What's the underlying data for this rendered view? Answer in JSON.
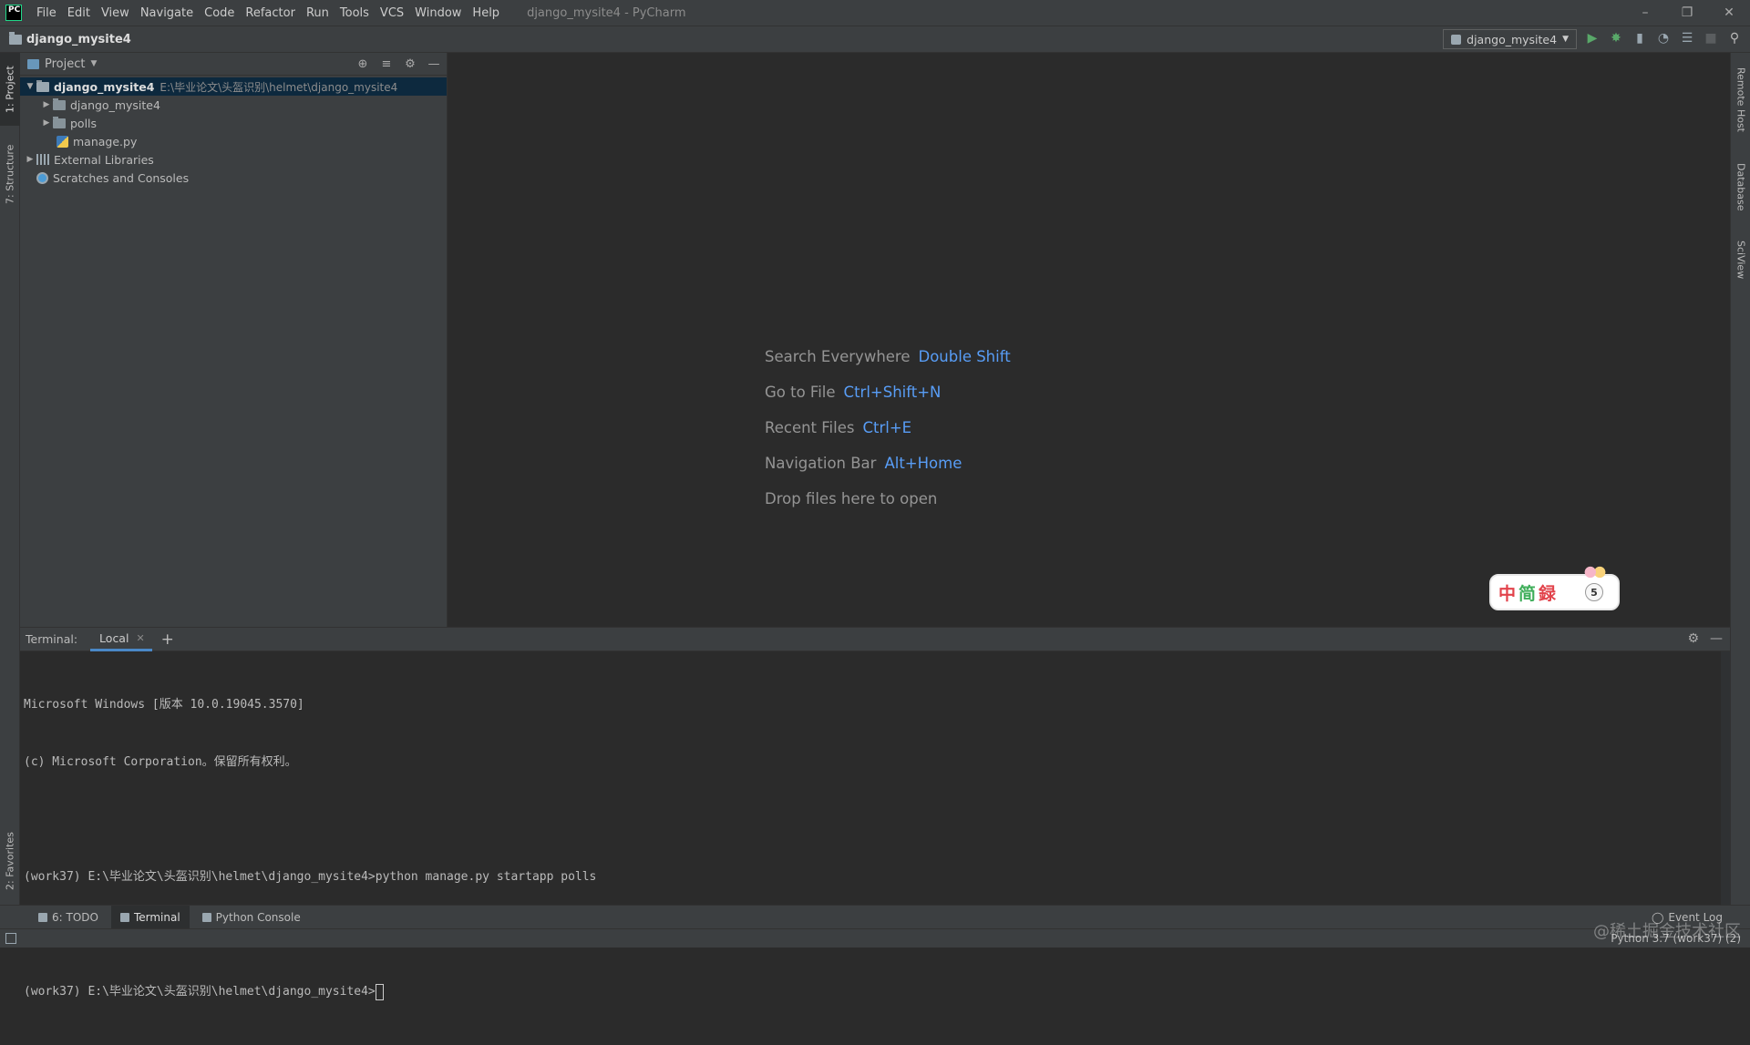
{
  "titlebar": {
    "menu": [
      "File",
      "Edit",
      "View",
      "Navigate",
      "Code",
      "Refactor",
      "Run",
      "Tools",
      "VCS",
      "Window",
      "Help"
    ],
    "window_title": "django_mysite4 - PyCharm"
  },
  "navbar": {
    "project": "django_mysite4",
    "run_config": "django_mysite4"
  },
  "left_stripe": {
    "project_tab": "1: Project",
    "structure_tab": "7: Structure",
    "favorites_tab": "2: Favorites"
  },
  "right_stripe": {
    "remote_host": "Remote Host",
    "database": "Database",
    "sciview": "SciView"
  },
  "project_panel": {
    "view_label": "Project",
    "tree": [
      {
        "label": "django_mysite4",
        "path": "E:\\毕业论文\\头盔识别\\helmet\\django_mysite4"
      },
      {
        "label": "django_mysite4"
      },
      {
        "label": "polls"
      },
      {
        "label": "manage.py"
      },
      {
        "label": "External Libraries"
      },
      {
        "label": "Scratches and Consoles"
      }
    ]
  },
  "editor": {
    "hints": [
      {
        "text": "Search Everywhere",
        "key": "Double Shift"
      },
      {
        "text": "Go to File",
        "key": "Ctrl+Shift+N"
      },
      {
        "text": "Recent Files",
        "key": "Ctrl+E"
      },
      {
        "text": "Navigation Bar",
        "key": "Alt+Home"
      },
      {
        "text": "Drop files here to open",
        "key": ""
      }
    ],
    "sticker": {
      "c1": "中",
      "c2": "简",
      "c3": "録",
      "badge": "5"
    }
  },
  "terminal": {
    "title": "Terminal:",
    "tab": "Local",
    "lines": [
      "Microsoft Windows [版本 10.0.19045.3570]",
      "(c) Microsoft Corporation。保留所有权利。",
      "",
      "(work37) E:\\毕业论文\\头盔识别\\helmet\\django_mysite4>python manage.py startapp polls",
      "",
      "(work37) E:\\毕业论文\\头盔识别\\helmet\\django_mysite4>"
    ]
  },
  "bottom_tabs": {
    "todo": "6: TODO",
    "terminal": "Terminal",
    "python_console": "Python Console",
    "event_log": "Event Log"
  },
  "statusbar": {
    "interpreter": "Python 3.7 (work37) (2)",
    "watermark": "@稀土掘金技术社区"
  },
  "colors": {
    "background": "#2b2b2b",
    "panel": "#3c3f41",
    "selection": "#0d293e",
    "shortcut": "#589df6",
    "run_green": "#59a869"
  }
}
